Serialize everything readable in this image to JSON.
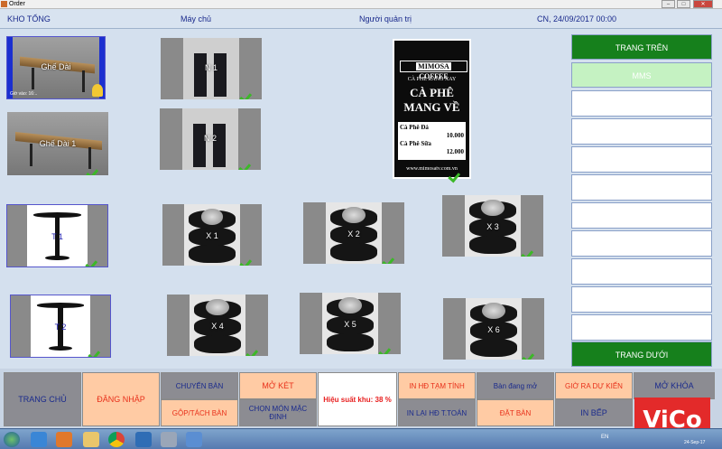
{
  "window": {
    "title": "Order"
  },
  "header": {
    "store": "KHO TỔNG",
    "machine": "Máy chủ",
    "user": "Người quản trị",
    "datetime": "CN, 24/09/2017 00:00"
  },
  "tables": [
    {
      "name": "Ghế Dài",
      "kind": "bench",
      "note": "Giờ vào: 16:..",
      "occupied": true
    },
    {
      "name": "N 1",
      "kind": "chair"
    },
    {
      "name": "Ghế Dài 1",
      "kind": "bench"
    },
    {
      "name": "N 2",
      "kind": "chair"
    },
    {
      "name": "T 1",
      "kind": "table"
    },
    {
      "name": "X 1",
      "kind": "tire"
    },
    {
      "name": "X 2",
      "kind": "tire"
    },
    {
      "name": "X 3",
      "kind": "tire"
    },
    {
      "name": "T 2",
      "kind": "table"
    },
    {
      "name": "X 4",
      "kind": "tire"
    },
    {
      "name": "X 5",
      "kind": "tire"
    },
    {
      "name": "X 6",
      "kind": "tire"
    }
  ],
  "sign": {
    "brand_left": "MIMOSA",
    "brand_right": "COFFEE",
    "sub": "CÀ PHÊ RANG XAY",
    "line1": "CÀ PHÊ",
    "line2": "MANG VỀ",
    "item1_name": "Cà Phê Đá",
    "item1_price": "10.000",
    "item2_name": "Cà Phê Sữa",
    "item2_price": "12.000",
    "url": "www.mimosatv.com.vn"
  },
  "areas": {
    "top_button": "TRANG TRÊN",
    "bottom_button": "TRANG DƯỚI",
    "items": [
      "MMS"
    ]
  },
  "actions": {
    "home": "TRANG CHỦ",
    "login": "ĐĂNG NHẬP",
    "move_table": "CHUYỂN BÀN",
    "merge_split": "GỘP/TÁCH BÀN",
    "open_drawer": "MỞ KÉT",
    "choose_dish": "CHỌN MÓN MẶC ĐỊNH",
    "efficiency": "Hiệu suất khu: 38 %",
    "print_temp": "IN HĐ TẠM TÍNH",
    "reprint": "IN LẠI HĐ T.TOÁN",
    "open_tables": "Bàn đang mở",
    "reserve": "ĐẶT BÀN",
    "expected_out": "GIỜ RA DỰ KIẾN",
    "print_kitchen": "IN BẾP",
    "unlock": "MỞ KHÓA"
  },
  "watermark": "ViCo",
  "tray": {
    "lang": "EN",
    "date": "24-Sep-17"
  }
}
